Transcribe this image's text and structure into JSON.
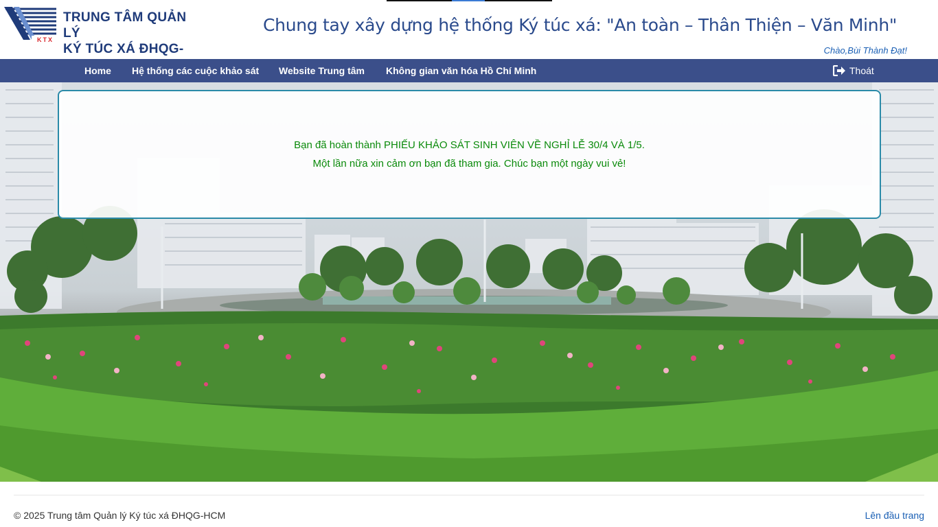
{
  "header": {
    "logo_line1": "TRUNG TÂM QUẢN LÝ",
    "logo_line2": "KÝ TÚC XÁ ĐHQG-HCM",
    "logo_badge": "KTX",
    "slogan": "Chung tay xây dựng hệ thống Ký túc xá: \"An toàn – Thân Thiện – Văn Minh\"",
    "greeting": "Chào,Bùi Thành Đạt!"
  },
  "nav": {
    "items": [
      {
        "label": "Home"
      },
      {
        "label": "Hệ thống các cuộc khảo sát"
      },
      {
        "label": "Website Trung tâm"
      },
      {
        "label": "Không gian văn hóa Hồ Chí Minh"
      }
    ],
    "logout_label": "Thoát",
    "logout_icon": "sign-out-icon"
  },
  "message": {
    "line1": "Bạn đã hoàn thành PHIẾU KHẢO SÁT SINH VIÊN VỀ NGHỈ LỄ 30/4 VÀ 1/5.",
    "line2": "Một lần nữa xin cảm ơn bạn đã tham gia. Chúc bạn một ngày vui vẻ!"
  },
  "footer": {
    "copyright": "© 2025 Trung tâm Quản lý Ký túc xá ĐHQG-HCM",
    "to_top": "Lên đầu trang"
  },
  "colors": {
    "navbar": "#3b4f8a",
    "slogan": "#2a4a8c",
    "message": "#0a8a0a",
    "link": "#1a5fb4",
    "card_border": "#2a8aa8"
  }
}
